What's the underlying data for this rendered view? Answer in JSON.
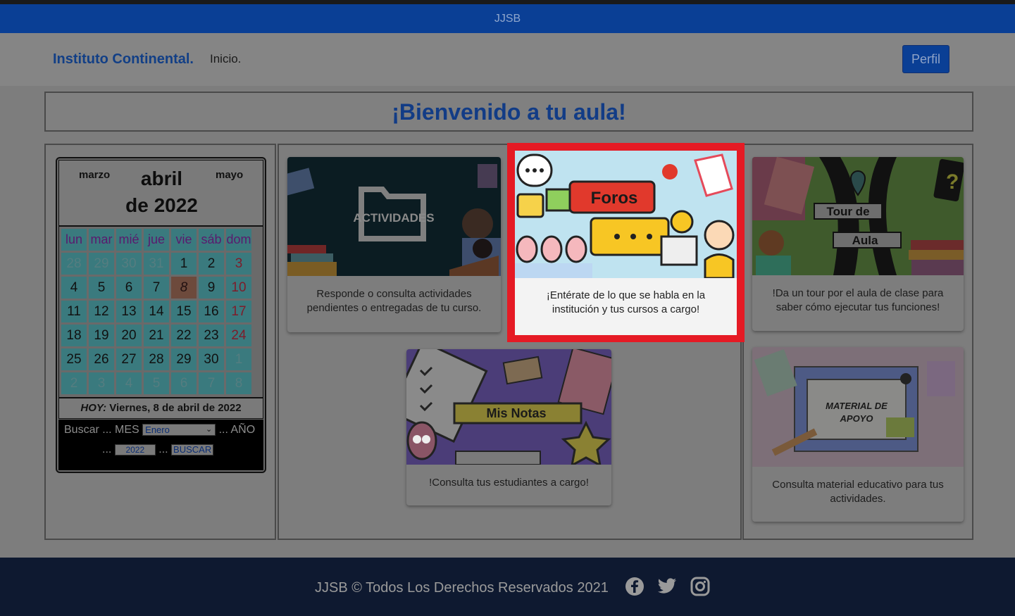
{
  "brand_bar": {
    "title": "JJSB"
  },
  "navbar": {
    "brand": "Instituto Continental.",
    "home_link": "Inicio.",
    "profile_button": "Perfil"
  },
  "welcome": {
    "title": "¡Bienvenido a tu aula!"
  },
  "calendar": {
    "prev_month": "marzo",
    "next_month": "mayo",
    "month": "abril",
    "year_line": "de 2022",
    "weekdays": [
      "lun",
      "mar",
      "mié",
      "jue",
      "vie",
      "sáb",
      "dom"
    ],
    "weeks": [
      [
        "28",
        "29",
        "30",
        "31",
        "1",
        "2",
        "3"
      ],
      [
        "4",
        "5",
        "6",
        "7",
        "8",
        "9",
        "10"
      ],
      [
        "11",
        "12",
        "13",
        "14",
        "15",
        "16",
        "17"
      ],
      [
        "18",
        "19",
        "20",
        "21",
        "22",
        "23",
        "24"
      ],
      [
        "25",
        "26",
        "27",
        "28",
        "29",
        "30",
        "1"
      ],
      [
        "2",
        "3",
        "4",
        "5",
        "6",
        "7",
        "8"
      ]
    ],
    "today_label": "HOY:",
    "today_text": "Viernes, 8 de abril de 2022",
    "search": {
      "buscar_label": "Buscar ... MES",
      "month_value": "Enero",
      "year_label": "... AÑO",
      "dots_before_year": "...",
      "year_value": "2022",
      "dots_before_button": "...",
      "button_label": "BUSCAR"
    }
  },
  "cards": {
    "actividades": {
      "image_label": "ACTIVIDADES",
      "text": "Responde o consulta actividades pendientes o entregadas de tu curso."
    },
    "foros": {
      "image_label": "Foros",
      "text": "¡Entérate de lo que se habla en la institución y tus cursos a cargo!"
    },
    "tour": {
      "image_label_1": "Tour de",
      "image_label_2": "Aula",
      "text": "!Da un tour por el aula de clase para saber cómo ejecutar tus funciones!"
    },
    "notas": {
      "image_label": "Mis Notas",
      "text": "!Consulta tus estudiantes a cargo!"
    },
    "material": {
      "image_label_1": "MATERIAL DE",
      "image_label_2": "APOYO",
      "text": "Consulta material educativo para tus actividades."
    }
  },
  "footer": {
    "copyright": "JJSB © Todos Los Derechos Reservados 2021",
    "social": [
      "facebook-icon",
      "twitter-icon",
      "instagram-icon"
    ]
  },
  "colors": {
    "highlight": "#e51a24",
    "brand_blue": "#0a3f95",
    "footer_bg": "#0e1930"
  }
}
